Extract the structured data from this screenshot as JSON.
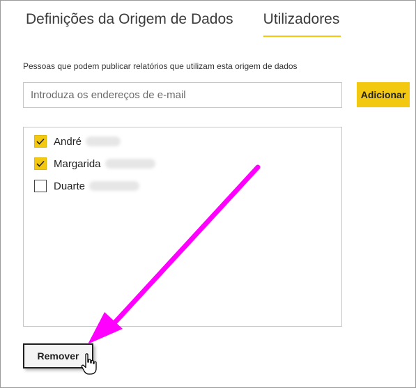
{
  "tabs": [
    {
      "label": "Definições da Origem de Dados",
      "active": false
    },
    {
      "label": "Utilizadores",
      "active": true
    }
  ],
  "description": "Pessoas que podem publicar relatórios que utilizam esta origem de dados",
  "email": {
    "placeholder": "Introduza os endereços de e-mail",
    "value": ""
  },
  "add_button_label": "Adicionar",
  "users": [
    {
      "name": "André",
      "checked": true
    },
    {
      "name": "Margarida",
      "checked": true
    },
    {
      "name": "Duarte",
      "checked": false
    }
  ],
  "remove_button_label": "Remover",
  "colors": {
    "accent": "#f2c811",
    "annotation_arrow": "#ff00ff"
  }
}
